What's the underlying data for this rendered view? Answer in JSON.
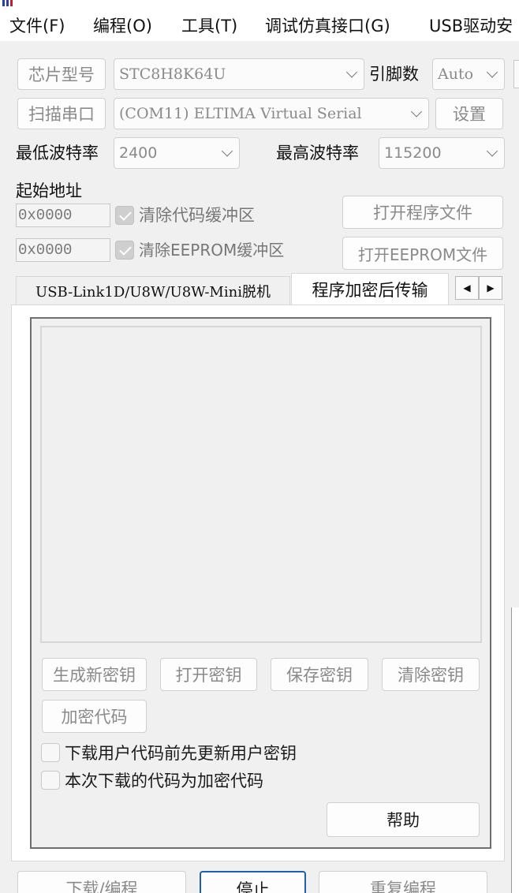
{
  "menu": {
    "items": [
      "文件(F)",
      "编程(O)",
      "工具(T)",
      "调试仿真接口(G)",
      "USB驱动安"
    ]
  },
  "chip": {
    "label": "芯片型号",
    "value": "STC8H8K64U",
    "pins_label": "引脚数",
    "pins_value": "Auto"
  },
  "port": {
    "scan_label": "扫描串口",
    "value": "(COM11) ELTIMA Virtual Serial",
    "settings_label": "设置"
  },
  "baud": {
    "min_label": "最低波特率",
    "min_value": "2400",
    "max_label": "最高波特率",
    "max_value": "115200"
  },
  "address": {
    "label": "起始地址",
    "code_addr": "0x0000",
    "clear_code_label": "清除代码缓冲区",
    "open_program_label": "打开程序文件",
    "eeprom_addr": "0x0000",
    "clear_eeprom_label": "清除EEPROM缓冲区",
    "open_eeprom_label": "打开EEPROM文件"
  },
  "tabs": {
    "inactive": "USB-Link1D/U8W/U8W-Mini脱机",
    "active": "程序加密后传输"
  },
  "encrypt": {
    "gen_key": "生成新密钥",
    "open_key": "打开密钥",
    "save_key": "保存密钥",
    "clear_key": "清除密钥",
    "encrypt_code": "加密代码",
    "opt_update_key": "下载用户代码前先更新用户密钥",
    "opt_encrypted": "本次下载的代码为加密代码",
    "help": "帮助"
  },
  "bottom": {
    "download": "下载/编程",
    "stop": "停止",
    "reprogram": "重复编程"
  },
  "colors": {
    "annotation_red": "#e0202a",
    "default_button_border": "#1f5fb3"
  }
}
